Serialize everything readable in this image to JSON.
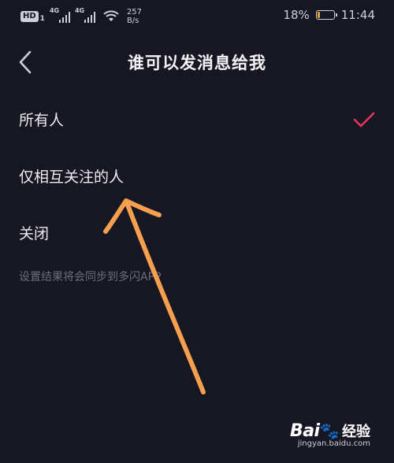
{
  "status_bar": {
    "hd_badge": "HD",
    "sim_number": "1",
    "network_1": "4G",
    "network_2": "4G",
    "speed_value": "257",
    "speed_unit": "B/s",
    "battery_percent": "18%",
    "battery_level": 0.18,
    "time": "11:44",
    "icons": [
      "hd-icon",
      "signal-icon",
      "signal-icon",
      "wifi-icon",
      "battery-charging-icon"
    ]
  },
  "nav": {
    "back_icon": "chevron-left-icon",
    "title": "谁可以发消息给我"
  },
  "options": [
    {
      "label": "所有人",
      "selected": true
    },
    {
      "label": "仅相互关注的人",
      "selected": false
    },
    {
      "label": "关闭",
      "selected": false
    }
  ],
  "footer_note": "设置结果将会同步到多闪APP",
  "colors": {
    "background": "#171724",
    "accent_check": "#e8345a",
    "annotation_arrow": "#f4a04f",
    "muted_text": "#6c6c7c"
  },
  "watermark": {
    "logo_text": "Bai",
    "logo_suffix": "经验",
    "url": "jingyan.baidu.com"
  }
}
